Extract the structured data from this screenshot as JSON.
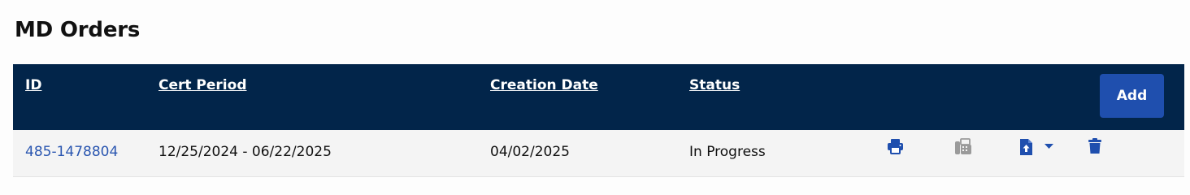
{
  "page": {
    "title": "MD Orders"
  },
  "table": {
    "headers": {
      "id": "ID",
      "cert_period": "Cert Period",
      "creation_date": "Creation Date",
      "status": "Status"
    },
    "add_label": "Add",
    "rows": [
      {
        "id": "485-1478804",
        "cert_period": "12/25/2024 - 06/22/2025",
        "creation_date": "04/02/2025",
        "status": "In Progress",
        "actions": [
          "printer-icon",
          "fax-icon",
          "upload-file-icon",
          "chevron-down-icon",
          "trash-icon"
        ]
      }
    ]
  },
  "colors": {
    "header_bg": "#02254a",
    "accent": "#1f4fae",
    "link": "#2a56b0",
    "disabled_icon": "#9a9a9a"
  }
}
